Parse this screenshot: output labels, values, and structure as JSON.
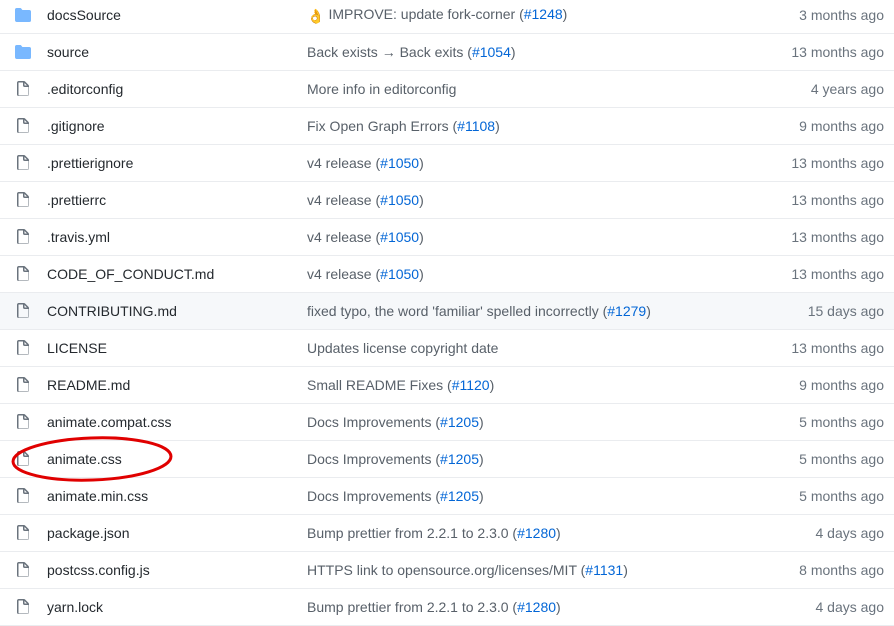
{
  "files": [
    {
      "type": "dir",
      "name": "docsSource",
      "emoji": "👌",
      "msg": "IMPROVE: update fork-corner (",
      "pr": "#1248",
      "msg_end": ")",
      "age": "3 months ago"
    },
    {
      "type": "dir",
      "name": "source",
      "msg": "Back exists → Back exits (",
      "pr": "#1054",
      "msg_end": ")",
      "age": "13 months ago"
    },
    {
      "type": "file",
      "name": ".editorconfig",
      "msg": "More info in editorconfig",
      "age": "4 years ago"
    },
    {
      "type": "file",
      "name": ".gitignore",
      "msg": "Fix Open Graph Errors (",
      "pr": "#1108",
      "msg_end": ")",
      "age": "9 months ago"
    },
    {
      "type": "file",
      "name": ".prettierignore",
      "msg": "v4 release (",
      "pr": "#1050",
      "msg_end": ")",
      "age": "13 months ago"
    },
    {
      "type": "file",
      "name": ".prettierrc",
      "msg": "v4 release (",
      "pr": "#1050",
      "msg_end": ")",
      "age": "13 months ago"
    },
    {
      "type": "file",
      "name": ".travis.yml",
      "msg": "v4 release (",
      "pr": "#1050",
      "msg_end": ")",
      "age": "13 months ago"
    },
    {
      "type": "file",
      "name": "CODE_OF_CONDUCT.md",
      "msg": "v4 release (",
      "pr": "#1050",
      "msg_end": ")",
      "age": "13 months ago"
    },
    {
      "type": "file",
      "name": "CONTRIBUTING.md",
      "msg": "fixed typo, the word 'familiar' spelled incorrectly (",
      "pr": "#1279",
      "msg_end": ")",
      "age": "15 days ago",
      "hover": true
    },
    {
      "type": "file",
      "name": "LICENSE",
      "msg": "Updates license copyright date",
      "age": "13 months ago"
    },
    {
      "type": "file",
      "name": "README.md",
      "msg": "Small README Fixes (",
      "pr": "#1120",
      "msg_end": ")",
      "age": "9 months ago"
    },
    {
      "type": "file",
      "name": "animate.compat.css",
      "msg": "Docs Improvements (",
      "pr": "#1205",
      "msg_end": ")",
      "age": "5 months ago"
    },
    {
      "type": "file",
      "name": "animate.css",
      "msg": "Docs Improvements (",
      "pr": "#1205",
      "msg_end": ")",
      "age": "5 months ago",
      "circled": true
    },
    {
      "type": "file",
      "name": "animate.min.css",
      "msg": "Docs Improvements (",
      "pr": "#1205",
      "msg_end": ")",
      "age": "5 months ago"
    },
    {
      "type": "file",
      "name": "package.json",
      "msg": "Bump prettier from 2.2.1 to 2.3.0 (",
      "pr": "#1280",
      "msg_end": ")",
      "age": "4 days ago"
    },
    {
      "type": "file",
      "name": "postcss.config.js",
      "msg": "HTTPS link to opensource.org/licenses/MIT (",
      "pr": "#1131",
      "msg_end": ")",
      "age": "8 months ago"
    },
    {
      "type": "file",
      "name": "yarn.lock",
      "msg": "Bump prettier from 2.2.1 to 2.3.0 (",
      "pr": "#1280",
      "msg_end": ")",
      "age": "4 days ago"
    }
  ],
  "colors": {
    "folder": "#79b8ff",
    "link": "#0366d6",
    "annotation": "#e00000"
  },
  "icons": {
    "dir": "folder-icon",
    "file": "file-icon"
  }
}
